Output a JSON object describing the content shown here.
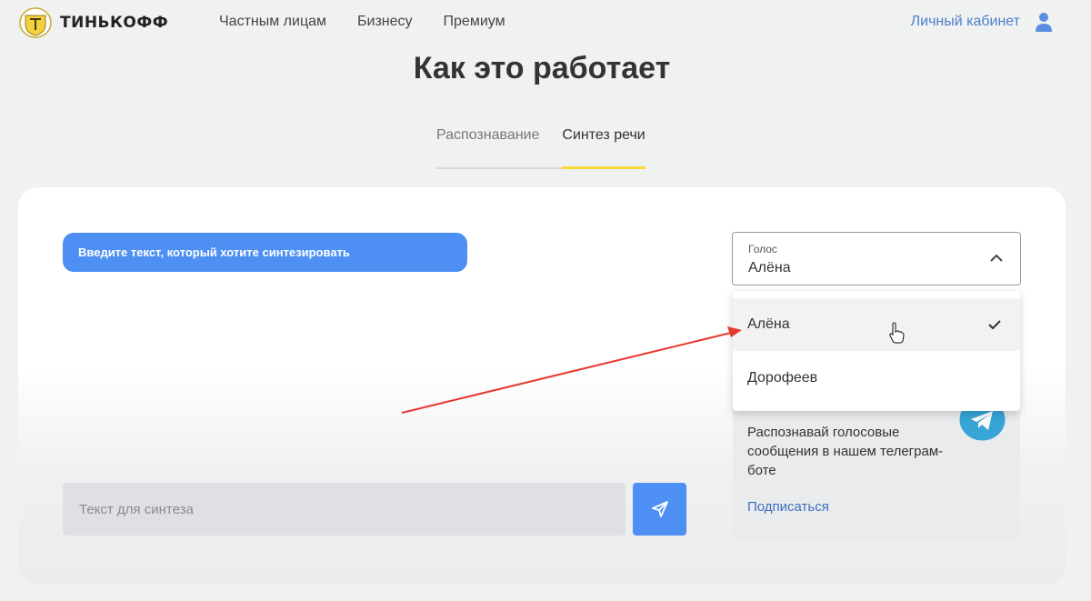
{
  "header": {
    "logo_text": "ТИНЬКОФФ",
    "nav": [
      "Частным лицам",
      "Бизнесу",
      "Премиум"
    ],
    "cabinet_label": "Личный кабинет"
  },
  "page": {
    "title": "Как это работает"
  },
  "tabs": [
    {
      "label": "Распознавание",
      "active": false
    },
    {
      "label": "Синтез речи",
      "active": true
    }
  ],
  "synth": {
    "prompt": "Введите текст, который хотите синтезировать",
    "input_placeholder": "Текст для синтеза"
  },
  "voice": {
    "label": "Голос",
    "selected": "Алёна",
    "options": [
      {
        "label": "Алёна",
        "selected": true
      },
      {
        "label": "Дорофеев",
        "selected": false
      }
    ]
  },
  "telegram": {
    "text": "Распознавай голосовые сообщения в нашем телеграм-боте",
    "link": "Подписаться"
  },
  "colors": {
    "accent": "#4d8ff3",
    "tab_underline": "#f7d93a",
    "link": "#4c7fd0",
    "annotation_arrow": "#e53a2f",
    "telegram": "#37a5d6"
  }
}
